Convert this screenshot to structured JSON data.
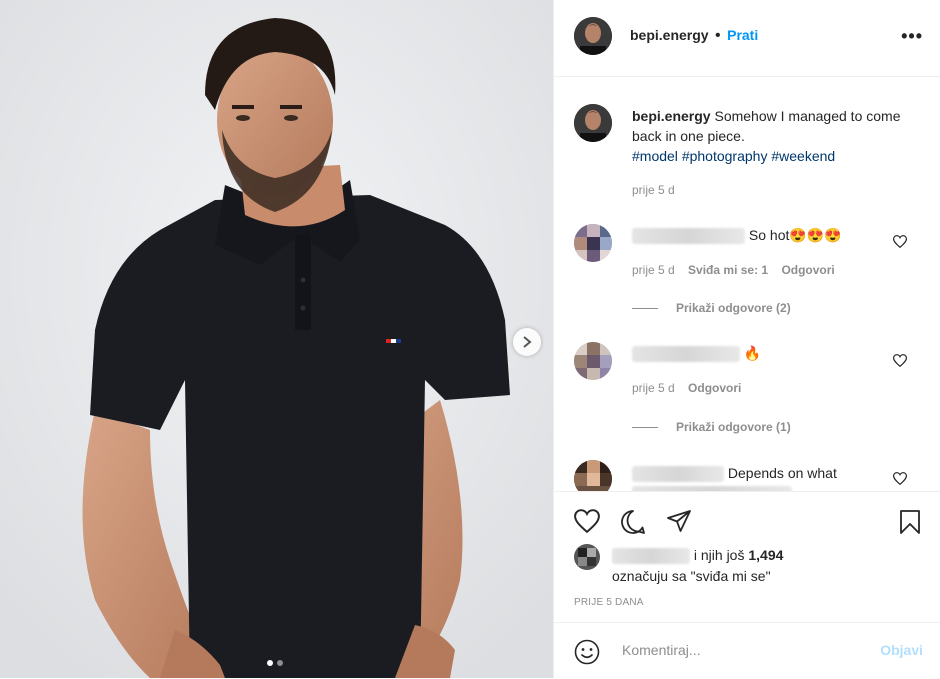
{
  "post": {
    "username": "bepi.energy",
    "follow_label": "Prati",
    "more_icon": "•••",
    "caption_text": "Somehow I managed to come back in one piece.",
    "hashtags": [
      "#model",
      "#photography",
      "#weekend"
    ],
    "caption_time": "prije 5 d"
  },
  "comments": [
    {
      "text": "So hot😍😍😍",
      "time": "prije 5 d",
      "likes_label": "Sviđa mi se: 1",
      "reply_label": "Odgovori",
      "view_replies": "Prikaži odgovore (2)"
    },
    {
      "text": "🔥",
      "time": "prije 5 d",
      "reply_label": "Odgovori",
      "view_replies": "Prikaži odgovore (1)"
    },
    {
      "text": "Depends on what",
      "text2": "...\"..."
    }
  ],
  "likes": {
    "suffix": "i njih još",
    "count": "1,494",
    "line2": "označuju sa \"sviđa mi se\""
  },
  "post_date": "PRIJE 5 DANA",
  "comment_box": {
    "placeholder": "Komentiraj...",
    "post_label": "Objavi"
  },
  "colors": {
    "accent": "#0095f6",
    "shirt": "#1a1c22",
    "background": "#e9eaec"
  }
}
